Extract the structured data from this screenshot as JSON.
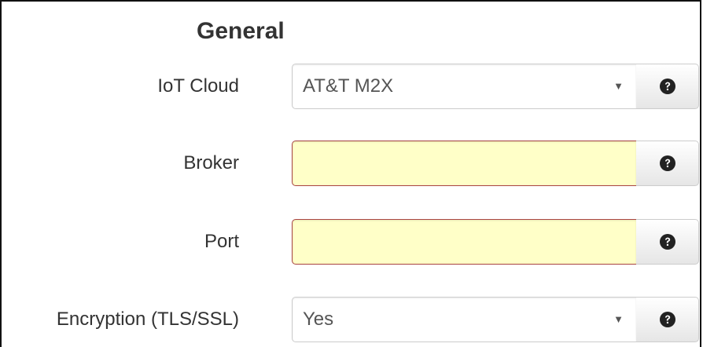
{
  "section": {
    "title": "General"
  },
  "fields": {
    "iot_cloud": {
      "label": "IoT Cloud",
      "value": "AT&T M2X",
      "caret": "▼",
      "help_icon": "question-circle-icon"
    },
    "broker": {
      "label": "Broker",
      "value": "",
      "help_icon": "question-circle-icon"
    },
    "port": {
      "label": "Port",
      "value": "",
      "help_icon": "question-circle-icon"
    },
    "encryption": {
      "label": "Encryption (TLS/SSL)",
      "value": "Yes",
      "caret": "▼",
      "help_icon": "question-circle-icon"
    }
  },
  "colors": {
    "invalid_input_bg": "#ffffc8",
    "invalid_input_border": "#a94442",
    "text": "#333333"
  }
}
